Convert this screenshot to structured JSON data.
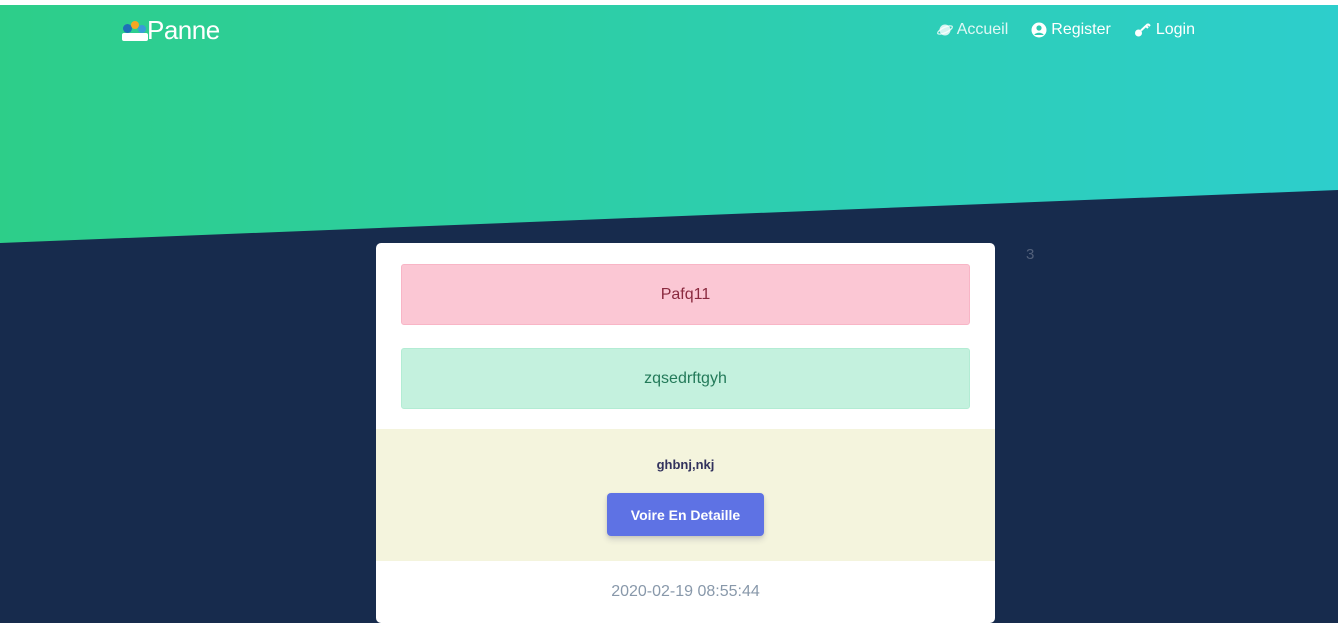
{
  "brand": {
    "name": "Panne",
    "logo_icon": "people-logo-icon"
  },
  "nav": {
    "items": [
      {
        "label": "Accueil",
        "icon": "planet-icon"
      },
      {
        "label": "Register",
        "icon": "user-circle-icon"
      },
      {
        "label": "Login",
        "icon": "key-icon"
      }
    ]
  },
  "side_number": "3",
  "card": {
    "title": "Pafq11",
    "description": "zqsedrftgyh",
    "body_text": "ghbnj,nkj",
    "button_label": "Voire En Detaille",
    "timestamp": "2020-02-19 08:55:44"
  },
  "colors": {
    "hero_gradient_start": "#2dce89",
    "hero_gradient_end": "#2dcecc",
    "background": "#172b4d",
    "button": "#5e72e4",
    "title_alert": "#fbc7d4",
    "desc_alert": "#c4f1de",
    "card_body": "#f4f4dd"
  }
}
